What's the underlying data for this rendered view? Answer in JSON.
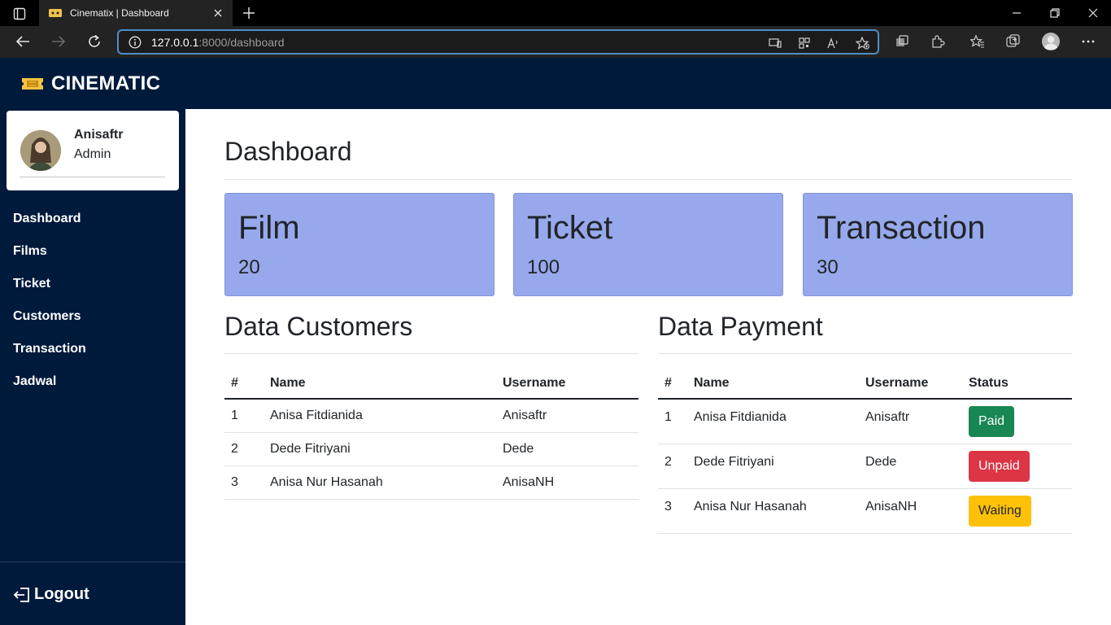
{
  "browser": {
    "tab_title": "Cinematix | Dashboard",
    "url_host": "127.0.0.1",
    "url_path": ":8000/dashboard"
  },
  "app": {
    "brand": "CINEMATIC"
  },
  "profile": {
    "name": "Anisaftr",
    "role": "Admin"
  },
  "sidebar": {
    "items": [
      {
        "label": "Dashboard"
      },
      {
        "label": "Films"
      },
      {
        "label": "Ticket"
      },
      {
        "label": "Customers"
      },
      {
        "label": "Transaction"
      },
      {
        "label": "Jadwal"
      }
    ],
    "logout_label": "Logout"
  },
  "page": {
    "title": "Dashboard"
  },
  "stats": [
    {
      "title": "Film",
      "value": "20"
    },
    {
      "title": "Ticket",
      "value": "100"
    },
    {
      "title": "Transaction",
      "value": "30"
    }
  ],
  "customers": {
    "title": "Data Customers",
    "headers": [
      "#",
      "Name",
      "Username"
    ],
    "rows": [
      {
        "no": "1",
        "name": "Anisa Fitdianida",
        "username": "Anisaftr"
      },
      {
        "no": "2",
        "name": "Dede Fitriyani",
        "username": "Dede"
      },
      {
        "no": "3",
        "name": "Anisa Nur Hasanah",
        "username": "AnisaNH"
      }
    ]
  },
  "payments": {
    "title": "Data Payment",
    "headers": [
      "#",
      "Name",
      "Username",
      "Status"
    ],
    "rows": [
      {
        "no": "1",
        "name": "Anisa Fitdianida",
        "username": "Anisaftr",
        "status": "Paid"
      },
      {
        "no": "2",
        "name": "Dede Fitriyani",
        "username": "Dede",
        "status": "Unpaid"
      },
      {
        "no": "3",
        "name": "Anisa Nur Hasanah",
        "username": "AnisaNH",
        "status": "Waiting"
      }
    ]
  },
  "colors": {
    "header_bg": "#001a3c",
    "stat_card_bg": "#97a9ec",
    "paid": "#198754",
    "unpaid": "#dc3545",
    "waiting": "#ffc107"
  }
}
